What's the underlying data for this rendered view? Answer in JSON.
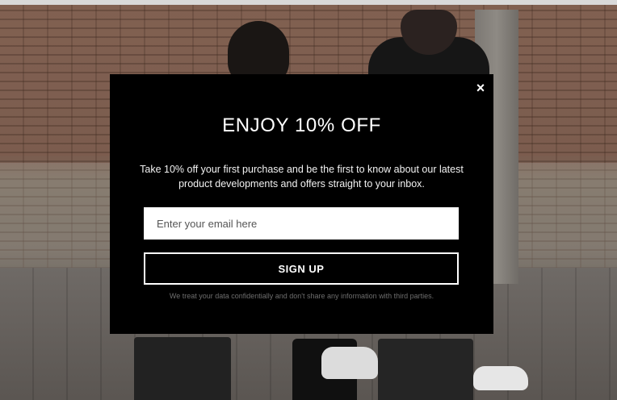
{
  "popup": {
    "close_symbol": "×",
    "title": "ENJOY 10% OFF",
    "description": "Take 10% off your first purchase and be the first to know about our latest product developments and offers straight to your inbox.",
    "email_placeholder": "Enter your email here",
    "email_value": "",
    "signup_label": "SIGN UP",
    "disclaimer": "We treat your data confidentially and don't share any information with third parties."
  },
  "colors": {
    "modal_background": "#000000",
    "modal_text": "#ffffff",
    "disclaimer_text": "#6e6e6e"
  },
  "icons": {
    "close": "close-icon"
  }
}
